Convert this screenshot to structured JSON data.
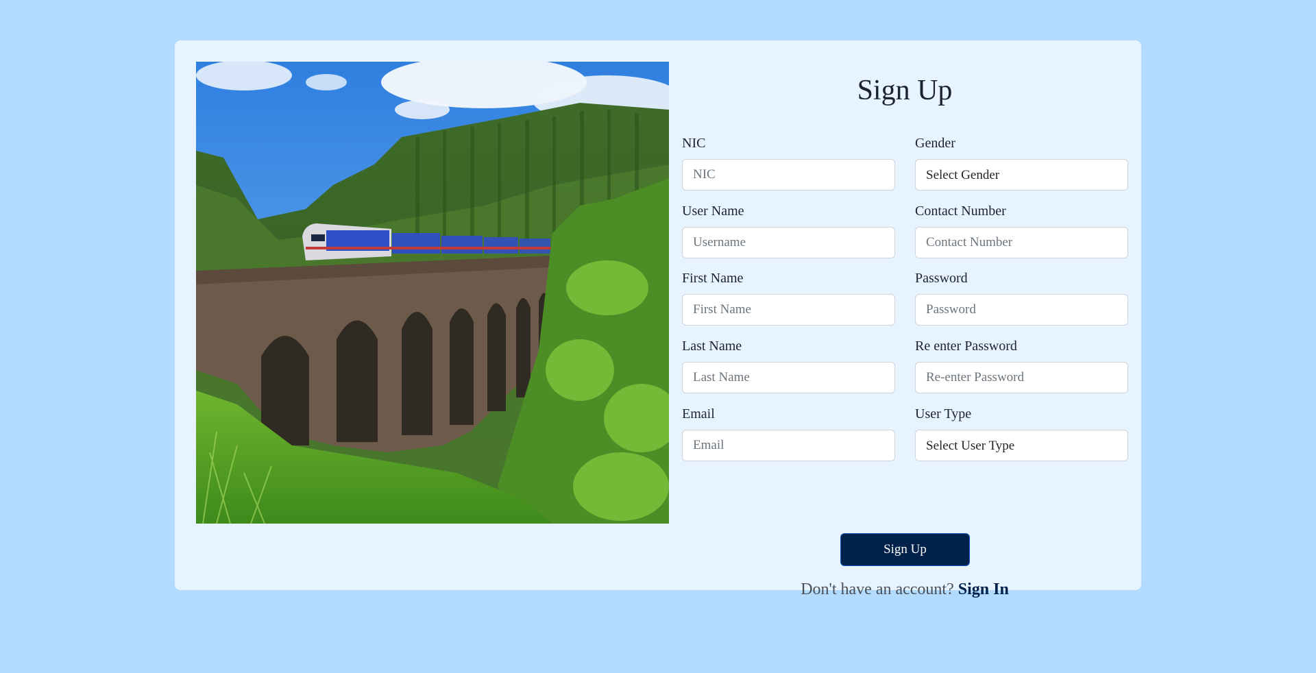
{
  "form": {
    "title": "Sign Up",
    "left_fields": [
      {
        "label": "NIC",
        "placeholder": "NIC"
      },
      {
        "label": "User Name",
        "placeholder": "Username"
      },
      {
        "label": "First Name",
        "placeholder": "First Name"
      },
      {
        "label": "Last Name",
        "placeholder": "Last Name"
      },
      {
        "label": "Email",
        "placeholder": "Email"
      }
    ],
    "right_fields": [
      {
        "label": "Gender",
        "selected": "Select Gender"
      },
      {
        "label": "Contact Number",
        "placeholder": "Contact Number"
      },
      {
        "label": "Password",
        "placeholder": "Password"
      },
      {
        "label": "Re enter Password",
        "placeholder": "Re-enter Password"
      },
      {
        "label": "User Type",
        "selected": "Select User Type"
      }
    ],
    "submit_label": "Sign Up",
    "footer_prompt": "Don't have an account?",
    "footer_link": "Sign In"
  },
  "colors": {
    "page_background": "#b3daff",
    "card_background": "#e7f3ff",
    "button_background": "#00224a",
    "link_color": "#00224a"
  },
  "image": {
    "subject": "train crossing a stone arch bridge in green forest"
  }
}
